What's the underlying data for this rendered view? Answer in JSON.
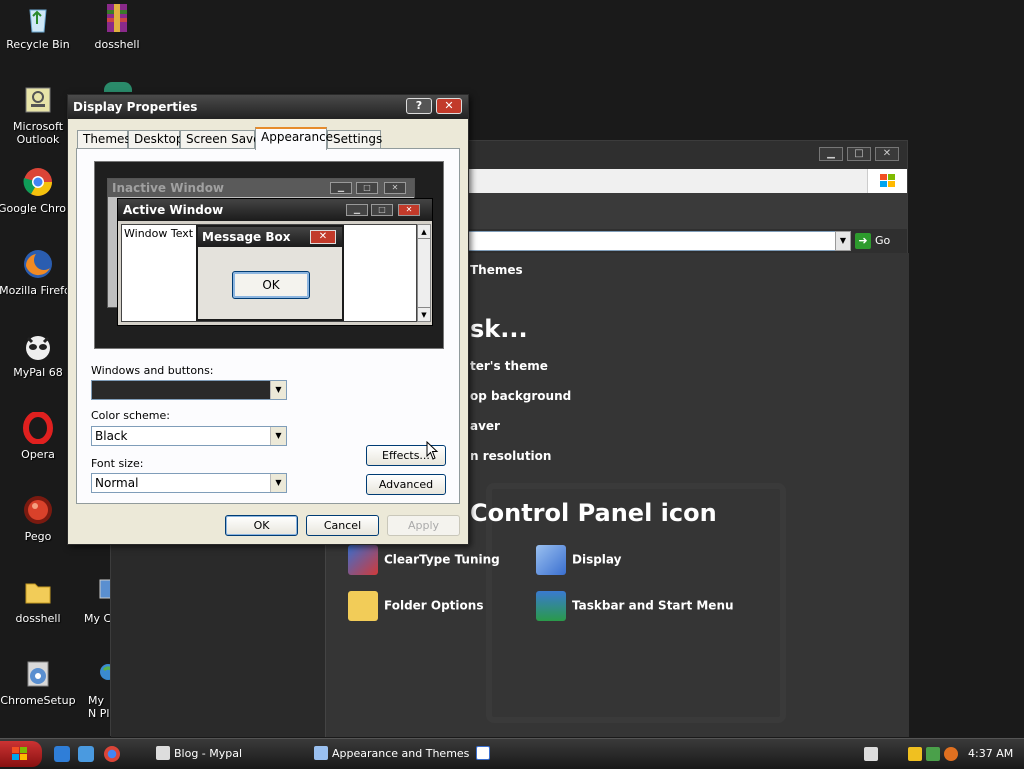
{
  "desktop": {
    "icons": [
      {
        "label": "Recycle Bin"
      },
      {
        "label": "dosshell"
      },
      {
        "label": "Microsoft Outlook"
      },
      {
        "label": "Google Chrome"
      },
      {
        "label": "Mozilla Firefox"
      },
      {
        "label": "MyPal 68"
      },
      {
        "label": "Opera"
      },
      {
        "label": "Pego"
      },
      {
        "label": "dosshell"
      },
      {
        "label": "ChromeSetup"
      },
      {
        "label": "My Co"
      },
      {
        "label": "My N Pl"
      }
    ]
  },
  "control_panel": {
    "go_label": "Go",
    "category_label": "Themes",
    "pick_task_heading": "sk...",
    "tasks": [
      "ter's theme",
      "op background",
      "aver",
      "n resolution"
    ],
    "pick_icon_heading": "Control Panel icon",
    "icons": [
      "ClearType Tuning",
      "Display",
      "Folder Options",
      "Taskbar and Start Menu"
    ]
  },
  "dialog": {
    "title": "Display Properties",
    "help_label": "?",
    "close_label": "✕",
    "tabs": [
      "Themes",
      "Desktop",
      "Screen Saver",
      "Appearance",
      "Settings"
    ],
    "active_tab": "Appearance",
    "preview": {
      "inactive_title": "Inactive Window",
      "active_title": "Active Window",
      "window_text": "Window Text",
      "message_title": "Message Box",
      "message_ok": "OK"
    },
    "windows_buttons_label": "Windows and buttons:",
    "windows_buttons_value": "",
    "color_scheme_label": "Color scheme:",
    "color_scheme_value": "Black",
    "font_size_label": "Font size:",
    "font_size_value": "Normal",
    "effects_label": "Effects...",
    "advanced_label": "Advanced",
    "ok_label": "OK",
    "cancel_label": "Cancel",
    "apply_label": "Apply"
  },
  "taskbar": {
    "tasks": [
      "Blog - Mypal",
      "Appearance and Themes",
      ""
    ],
    "clock": "4:37 AM"
  },
  "colors": {
    "desktop_bg": "#1a1a1a",
    "dialog_bg": "#ece9d8",
    "close_red": "#c23a2a",
    "active_tab_accent": "#e68b2c"
  }
}
